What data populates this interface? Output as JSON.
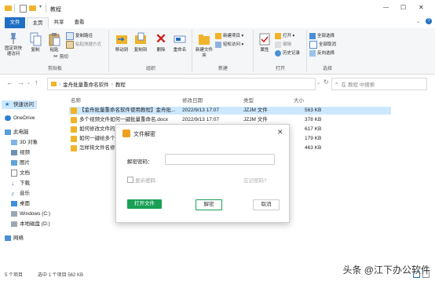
{
  "window": {
    "title": "教程",
    "controls": {
      "minimize": "—",
      "maximize": "☐",
      "close": "✕"
    }
  },
  "ribbon_tabs": [
    "文件",
    "主页",
    "共享",
    "查看"
  ],
  "ribbon": {
    "clipboard": {
      "label": "剪贴板",
      "pin": "固定到快速访问",
      "copy": "复制",
      "paste": "粘贴",
      "copy_path": "复制路径",
      "paste_shortcut": "粘贴快捷方式",
      "cut": "剪切"
    },
    "organize": {
      "label": "组织",
      "move_to": "移动到",
      "copy_to": "复制到",
      "delete": "删除",
      "rename": "重命名"
    },
    "new": {
      "label": "新建",
      "new_folder": "新建文件夹",
      "new_item": "新建项目 ▾",
      "easy_access": "轻松访问 ▾"
    },
    "open": {
      "label": "打开",
      "properties": "属性",
      "open": "打开 ▾",
      "edit": "编辑",
      "history": "历史记录"
    },
    "select": {
      "label": "选择",
      "select_all": "全部选择",
      "select_none": "全部取消",
      "invert": "反向选择"
    }
  },
  "address": {
    "path": [
      "金舟批量重命名软件",
      "教程"
    ],
    "search_placeholder": "在 教程 中搜索"
  },
  "nav_pane": [
    {
      "label": "快速访问",
      "icon": "star-icon",
      "level": 0
    },
    {
      "label": "OneDrive",
      "icon": "cloud-icon",
      "level": 0
    },
    {
      "label": "此电脑",
      "icon": "computer-icon",
      "level": 0
    },
    {
      "label": "3D 对象",
      "icon": "cube-icon",
      "level": 1
    },
    {
      "label": "视频",
      "icon": "video-icon",
      "level": 1
    },
    {
      "label": "图片",
      "icon": "picture-icon",
      "level": 1
    },
    {
      "label": "文档",
      "icon": "document-icon",
      "level": 1
    },
    {
      "label": "下载",
      "icon": "download-icon",
      "level": 1
    },
    {
      "label": "音乐",
      "icon": "music-icon",
      "level": 1
    },
    {
      "label": "桌面",
      "icon": "desktop-icon",
      "level": 1
    },
    {
      "label": "Windows (C:)",
      "icon": "drive-icon",
      "level": 1
    },
    {
      "label": "本地磁盘 (D:)",
      "icon": "drive-icon",
      "level": 1
    },
    {
      "label": "网络",
      "icon": "network-icon",
      "level": 0
    }
  ],
  "columns": {
    "name": "名称",
    "modified": "修改日期",
    "type": "类型",
    "size": "大小"
  },
  "files": [
    {
      "name": "【金舟批量重命名软件使用教程】金舟批...",
      "modified": "2022/9/13 17:07",
      "type": "JZJM 文件",
      "size": "563 KB",
      "selected": true
    },
    {
      "name": "多个视频文件如何一键批量重命名.docx",
      "modified": "2022/9/13 17:07",
      "type": "JZJM 文件",
      "size": "378 KB",
      "selected": false
    },
    {
      "name": "如何修改文件的",
      "modified": "",
      "type": "",
      "size": "617 KB",
      "selected": false
    },
    {
      "name": "如何一键给多个",
      "modified": "",
      "type": "",
      "size": "179 KB",
      "selected": false
    },
    {
      "name": "怎样将文件名修",
      "modified": "",
      "type": "",
      "size": "463 KB",
      "selected": false
    }
  ],
  "status": {
    "count": "5 个项目",
    "selection": "选中 1 个项目  562 KB"
  },
  "dialog": {
    "title": "文件解密",
    "close": "✕",
    "password_label": "解密密码：",
    "password_value": "",
    "show_password": "显示密码",
    "forgot": "忘记密码?",
    "open_file": "打开文件",
    "decrypt": "解密",
    "cancel": "取消"
  },
  "watermark": "头条 @江下办公软件",
  "colors": {
    "accent": "#1f6fc5",
    "selection": "#cce8ff",
    "green": "#1aa055",
    "folder": "#f0b32a"
  }
}
